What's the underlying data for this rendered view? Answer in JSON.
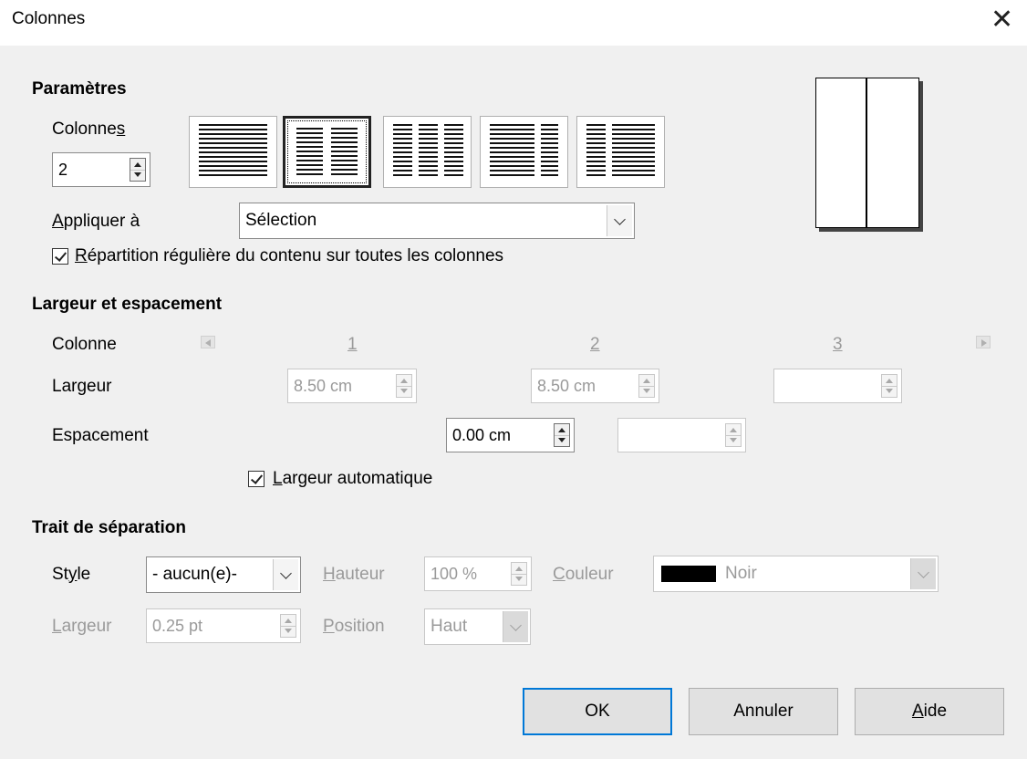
{
  "window": {
    "title": "Colonnes",
    "close_icon": "close-icon"
  },
  "parametres": {
    "heading": "Paramètres",
    "colonnes_label": "Colonnes",
    "colonnes_value": "2",
    "presets": [
      {
        "name": "1 colonne",
        "selected": false
      },
      {
        "name": "2 colonnes",
        "selected": true
      },
      {
        "name": "3 colonnes",
        "selected": false
      },
      {
        "name": "2 colonnes gauche",
        "selected": false
      },
      {
        "name": "2 colonnes droite",
        "selected": false
      }
    ],
    "appliquer_label": "Appliquer à",
    "appliquer_value": "Sélection",
    "repartition_label": "Répartition régulière du contenu sur toutes les colonnes",
    "repartition_checked": true
  },
  "largeur": {
    "heading": "Largeur et espacement",
    "colonne_label": "Colonne",
    "col_numbers": [
      "1",
      "2",
      "3"
    ],
    "largeur_label": "Largeur",
    "widths": [
      "8.50 cm",
      "8.50 cm",
      ""
    ],
    "espacement_label": "Espacement",
    "spacings": [
      "0.00 cm",
      ""
    ],
    "auto_label": "Largeur automatique",
    "auto_checked": true
  },
  "trait": {
    "heading": "Trait de séparation",
    "style_label": "Style",
    "style_value": "- aucun(e)-",
    "hauteur_label": "Hauteur",
    "hauteur_value": "100 %",
    "couleur_label": "Couleur",
    "couleur_value": "Noir",
    "couleur_swatch": "#000000",
    "largeur_label": "Largeur",
    "largeur_value": "0.25 pt",
    "position_label": "Position",
    "position_value": "Haut"
  },
  "buttons": {
    "ok": "OK",
    "annuler": "Annuler",
    "aide": "Aide"
  }
}
